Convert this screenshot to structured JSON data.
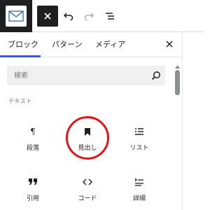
{
  "toolbar": {
    "logo_icon": "envelope-icon",
    "close_icon": "close-icon",
    "undo_icon": "undo-icon",
    "redo_icon": "redo-icon",
    "list_view_icon": "list-view-icon"
  },
  "inserter": {
    "tabs": [
      {
        "label": "ブロック",
        "active": true
      },
      {
        "label": "パターン",
        "active": false
      },
      {
        "label": "メディア",
        "active": false
      }
    ],
    "close_icon": "close-icon",
    "search": {
      "placeholder": "検索",
      "value": ""
    },
    "category": "テキスト",
    "blocks": [
      {
        "label": "段落",
        "icon": "paragraph-icon"
      },
      {
        "label": "見出し",
        "icon": "heading-bookmark-icon",
        "highlighted": true
      },
      {
        "label": "リスト",
        "icon": "list-icon"
      },
      {
        "label": "引用",
        "icon": "quote-icon"
      },
      {
        "label": "コード",
        "icon": "code-icon"
      },
      {
        "label": "詳細",
        "icon": "details-icon"
      }
    ]
  },
  "colors": {
    "accent": "#3858e9",
    "highlight_ring": "#e4141b",
    "toolbar_dark": "#1e1e1e"
  }
}
